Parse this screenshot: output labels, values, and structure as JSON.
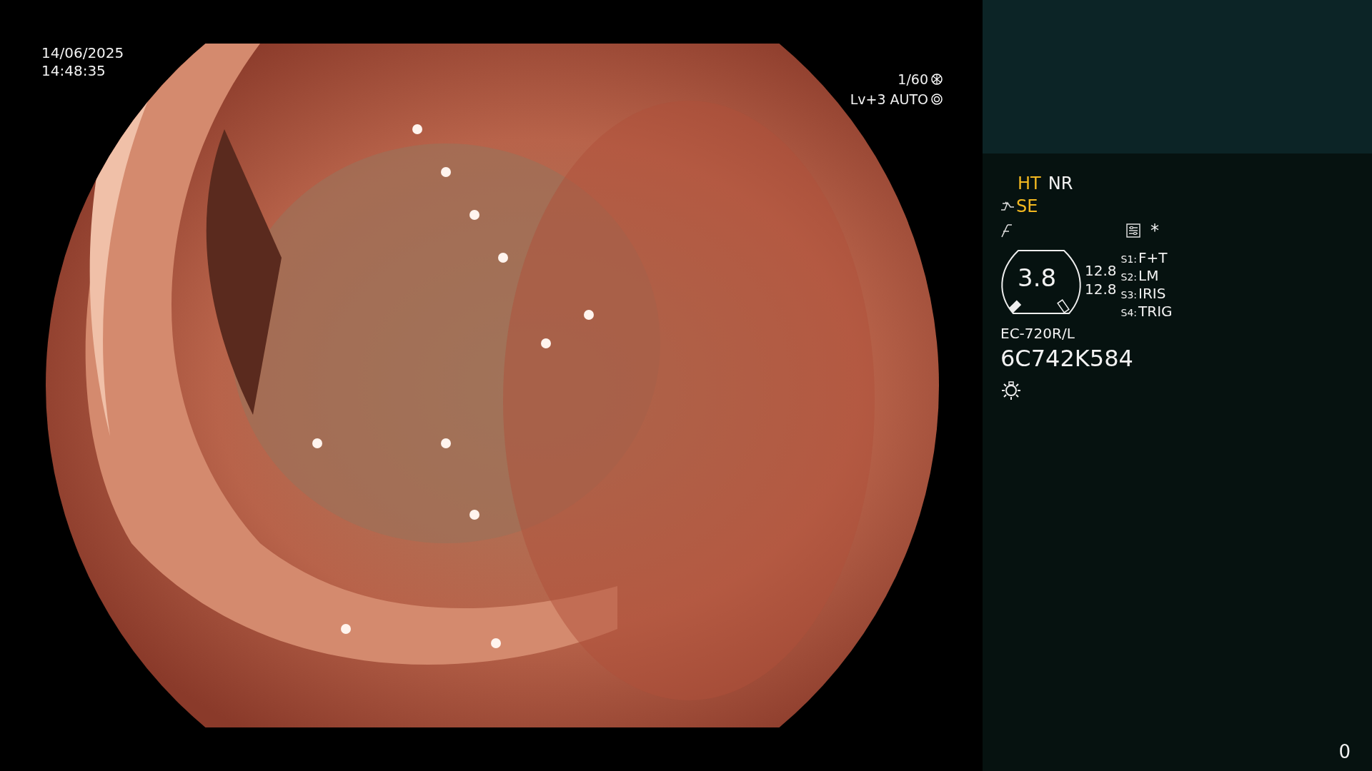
{
  "timestamp": {
    "date": "14/06/2025",
    "time": "14:48:35"
  },
  "exposure": {
    "shutter": "1/60",
    "mode": "Lv+3 AUTO"
  },
  "status_panel": {
    "modes": [
      {
        "label": "HT",
        "active": true
      },
      {
        "label": "NR",
        "active": false
      }
    ],
    "enhancement": {
      "label": "SE",
      "active": true
    },
    "asterisk": "*",
    "magnification": "3.8",
    "readings": [
      "12.8",
      "12.8"
    ],
    "switches": [
      {
        "key": "S1:",
        "value": "F+T"
      },
      {
        "key": "S2:",
        "value": "LM"
      },
      {
        "key": "S3:",
        "value": "IRIS"
      },
      {
        "key": "S4:",
        "value": "TRIG"
      }
    ],
    "scope_model": "EC-720R/L",
    "serial": "6C742K584"
  },
  "counter": "0"
}
